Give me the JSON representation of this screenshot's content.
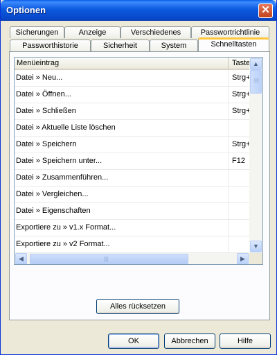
{
  "window": {
    "title": "Optionen",
    "close_label": "✕"
  },
  "tabs": {
    "row_back": [
      "Sicherungen",
      "Anzeige",
      "Verschiedenes",
      "Passwortrichtlinie"
    ],
    "row_front": [
      "Passworthistorie",
      "Sicherheit",
      "System",
      "Schnelltasten"
    ],
    "active": "Schnelltasten"
  },
  "table": {
    "columns": [
      "Menüeintrag",
      "Taste"
    ],
    "rows": [
      {
        "item": "Datei » Neu...",
        "key": "Strg+N"
      },
      {
        "item": "Datei » Öffnen...",
        "key": "Strg+O"
      },
      {
        "item": "Datei » Schließen",
        "key": "Strg+W"
      },
      {
        "item": "Datei » Aktuelle Liste löschen",
        "key": ""
      },
      {
        "item": "Datei » Speichern",
        "key": "Strg+S"
      },
      {
        "item": "Datei » Speichern unter...",
        "key": "F12"
      },
      {
        "item": "Datei » Zusammenführen...",
        "key": ""
      },
      {
        "item": "Datei » Vergleichen...",
        "key": ""
      },
      {
        "item": "Datei » Eigenschaften",
        "key": ""
      },
      {
        "item": "Exportiere zu » v1.x Format...",
        "key": ""
      },
      {
        "item": "Exportiere zu » v2 Format...",
        "key": ""
      }
    ]
  },
  "scrollbars": {
    "up": "▲",
    "down": "▼",
    "left": "◀",
    "right": "▶",
    "grip": "|||"
  },
  "buttons": {
    "reset": "Alles rücksetzen",
    "ok": "OK",
    "cancel": "Abbrechen",
    "help": "Hilfe"
  }
}
